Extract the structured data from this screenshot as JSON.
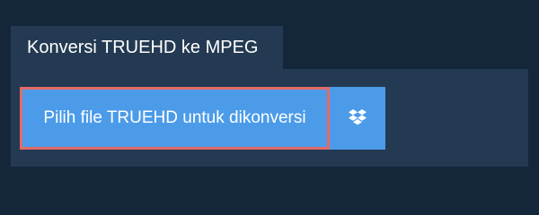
{
  "tab": {
    "label": "Konversi TRUEHD ke MPEG"
  },
  "uploader": {
    "choose_file_label": "Pilih file TRUEHD untuk dikonversi",
    "dropbox_icon": "dropbox-icon"
  },
  "colors": {
    "background": "#14263a",
    "panel": "#233a52",
    "button": "#4b9be9",
    "button_focus_border": "#e46a66",
    "text": "#ffffff"
  }
}
